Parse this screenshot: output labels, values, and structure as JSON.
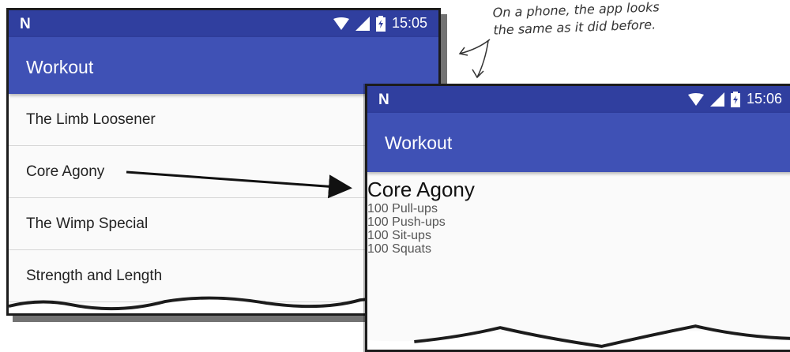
{
  "phone1": {
    "status": {
      "carrier_logo": "N",
      "time": "15:05"
    },
    "appbar_title": "Workout",
    "items": [
      {
        "label": "The Limb Loosener"
      },
      {
        "label": "Core Agony"
      },
      {
        "label": "The Wimp Special"
      },
      {
        "label": "Strength and Length"
      }
    ]
  },
  "phone2": {
    "status": {
      "carrier_logo": "N",
      "time": "15:06"
    },
    "appbar_title": "Workout",
    "detail": {
      "title": "Core Agony",
      "lines": [
        "100 Pull-ups",
        "100 Push-ups",
        "100 Sit-ups",
        "100 Squats"
      ]
    }
  },
  "annotation": {
    "line1": "On a phone, the app looks",
    "line2": "the same as it did before."
  },
  "icons": [
    "wifi-icon",
    "signal-icon",
    "battery-icon"
  ],
  "colors": {
    "status_bar": "#303f9f",
    "app_bar": "#3f51b5",
    "background": "#fafafa"
  }
}
